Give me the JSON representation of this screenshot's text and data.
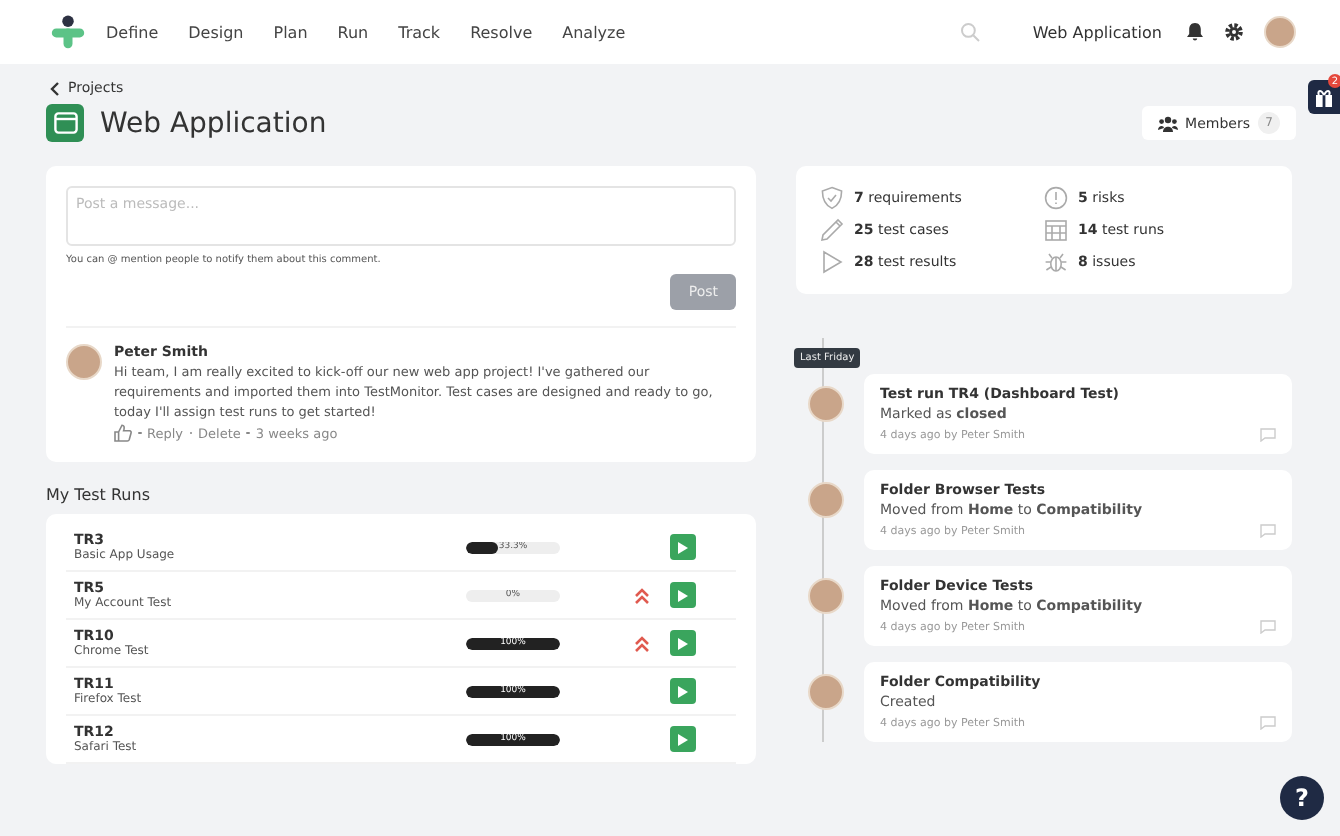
{
  "nav": {
    "items": [
      {
        "label": "Define"
      },
      {
        "label": "Design"
      },
      {
        "label": "Plan"
      },
      {
        "label": "Run"
      },
      {
        "label": "Track"
      },
      {
        "label": "Resolve"
      },
      {
        "label": "Analyze"
      }
    ],
    "project": "Web Application"
  },
  "header": {
    "back": "Projects",
    "title": "Web Application",
    "members_label": "Members",
    "members_count": "7",
    "gift_count": "2"
  },
  "comment_box": {
    "placeholder": "Post a message...",
    "hint": "You can @ mention people to notify them about this comment.",
    "button": "Post"
  },
  "comments": [
    {
      "author": "Peter Smith",
      "text": "Hi team, I am really excited to kick-off our new web app project! I've gathered our requirements and imported them into TestMonitor. Test cases are designed and ready to go, today I'll assign test runs to get started!",
      "actions": [
        "Reply",
        "Delete"
      ],
      "time": "3 weeks ago"
    }
  ],
  "test_runs": {
    "title": "My Test Runs",
    "rows": [
      {
        "code": "TR3",
        "name": "Basic App Usage",
        "level": 0.333,
        "reading": "33.3%",
        "high_priority": false
      },
      {
        "code": "TR5",
        "name": "My Account Test",
        "level": 0,
        "reading": "0%",
        "high_priority": true
      },
      {
        "code": "TR10",
        "name": "Chrome Test",
        "level": 1,
        "reading": "100%",
        "high_priority": true
      },
      {
        "code": "TR11",
        "name": "Firefox Test",
        "level": 1,
        "reading": "100%",
        "high_priority": false
      },
      {
        "code": "TR12",
        "name": "Safari Test",
        "level": 1,
        "reading": "100%",
        "high_priority": false
      }
    ]
  },
  "stats": [
    {
      "kind": "shield",
      "count": "7",
      "label": "requirements"
    },
    {
      "kind": "alert",
      "count": "5",
      "label": "risks"
    },
    {
      "kind": "pencil",
      "count": "25",
      "label": "test cases"
    },
    {
      "kind": "calendar",
      "count": "14",
      "label": "test runs"
    },
    {
      "kind": "play",
      "count": "28",
      "label": "test results"
    },
    {
      "kind": "bug",
      "count": "8",
      "label": "issues"
    }
  ],
  "timeline": {
    "label": "Last Friday",
    "items": [
      {
        "title": "Test run TR4 (Dashboard Test)",
        "detail": "Marked as **closed**",
        "meta": "4 days ago by Peter Smith"
      },
      {
        "title": "Folder Browser Tests",
        "detail": "Moved from **Home** to **Compatibility**",
        "meta": "4 days ago by Peter Smith"
      },
      {
        "title": "Folder Device Tests",
        "detail": "Moved from **Home** to **Compatibility**",
        "meta": "4 days ago by Peter Smith"
      },
      {
        "title": "Folder Compatibility",
        "detail": "Created",
        "meta": "4 days ago by Peter Smith"
      }
    ]
  },
  "help": "?"
}
